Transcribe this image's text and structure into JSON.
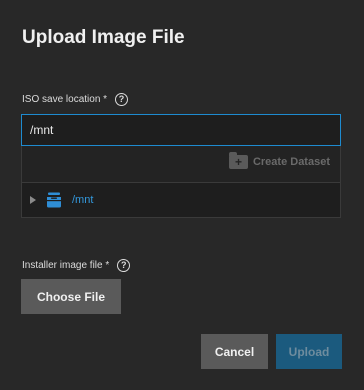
{
  "dialog": {
    "title": "Upload Image File"
  },
  "iso_location": {
    "label": "ISO save location *",
    "value": "/mnt"
  },
  "explorer": {
    "create_dataset_label": "Create Dataset",
    "tree": [
      {
        "label": "/mnt",
        "icon": "dataset-icon",
        "expanded": false
      }
    ]
  },
  "installer": {
    "label": "Installer image file *",
    "choose_label": "Choose File"
  },
  "actions": {
    "cancel_label": "Cancel",
    "upload_label": "Upload"
  },
  "colors": {
    "accent": "#1e8bd0",
    "upload_disabled": "#1b5a7e",
    "secondary_button": "#5a5a5a",
    "background": "#282828"
  }
}
